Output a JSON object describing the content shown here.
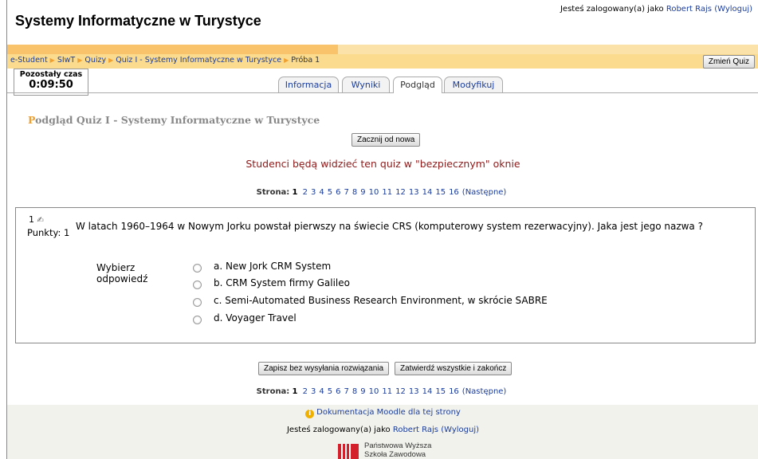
{
  "header": {
    "site_title": "Systemy Informatyczne w Turystyce",
    "login_prefix": "Jesteś zalogowany(a) jako",
    "user_name": "Robert Rajs",
    "logout_label": "(Wyloguj)"
  },
  "breadcrumb": {
    "items": [
      "e-Student",
      "SIwT",
      "Quizy",
      "Quiz I - Systemy Informatyczne w Turystyce",
      "Próba 1"
    ]
  },
  "buttons": {
    "change_quiz": "Zmień Quiz",
    "restart": "Zacznij od nowa",
    "save_without_submit": "Zapisz bez wysyłania rozwiązania",
    "submit_all": "Zatwierdź wszystkie i zakończ"
  },
  "timer": {
    "label": "Pozostały czas",
    "value": "0:09:50"
  },
  "tabs": [
    {
      "label": "Informacja",
      "active": false
    },
    {
      "label": "Wyniki",
      "active": false
    },
    {
      "label": "Podgląd",
      "active": true
    },
    {
      "label": "Modyfikuj",
      "active": false
    }
  ],
  "page_heading": {
    "first_letter": "P",
    "rest": "odgląd Quiz I - Systemy Informatyczne w Turystyce"
  },
  "secure_message": "Studenci będą widzieć ten quiz w \"bezpiecznym\" oknie",
  "pager": {
    "label": "Strona:",
    "current": "1",
    "pages": [
      "2",
      "3",
      "4",
      "5",
      "6",
      "7",
      "8",
      "9",
      "10",
      "11",
      "12",
      "13",
      "14",
      "15",
      "16"
    ],
    "next_label": "(Następne)"
  },
  "question": {
    "number": "1",
    "edit_icon": "pencil-icon",
    "points_label": "Punkty: 1",
    "text": "W latach 1960–1964 w Nowym Jorku powstał pierwszy na świecie CRS (komputerowy system rezerwacyjny). Jaka jest jego nazwa ?",
    "choose_label": "Wybierz odpowiedź",
    "answers": [
      "a. New Jork CRM System",
      "b. CRM System firmy Galileo",
      "c. Semi-Automated Business Research Environment, w skrócie SABRE",
      "d. Voyager Travel"
    ]
  },
  "footer": {
    "doc_link": "Dokumentacja Moodle dla tej strony",
    "login_prefix": "Jesteś zalogowany(a) jako",
    "user_name": "Robert Rajs",
    "logout_label": "(Wyloguj)",
    "logo_line1": "Państwowa Wyższa",
    "logo_line2": "Szkoła Zawodowa"
  },
  "colors": {
    "nav_bar": "#fbdb8d",
    "nav_bar_dark": "#f8c36a",
    "link": "#1a3d9e",
    "secure_message": "#8b1a1a",
    "heading_accent": "#f0a030"
  }
}
